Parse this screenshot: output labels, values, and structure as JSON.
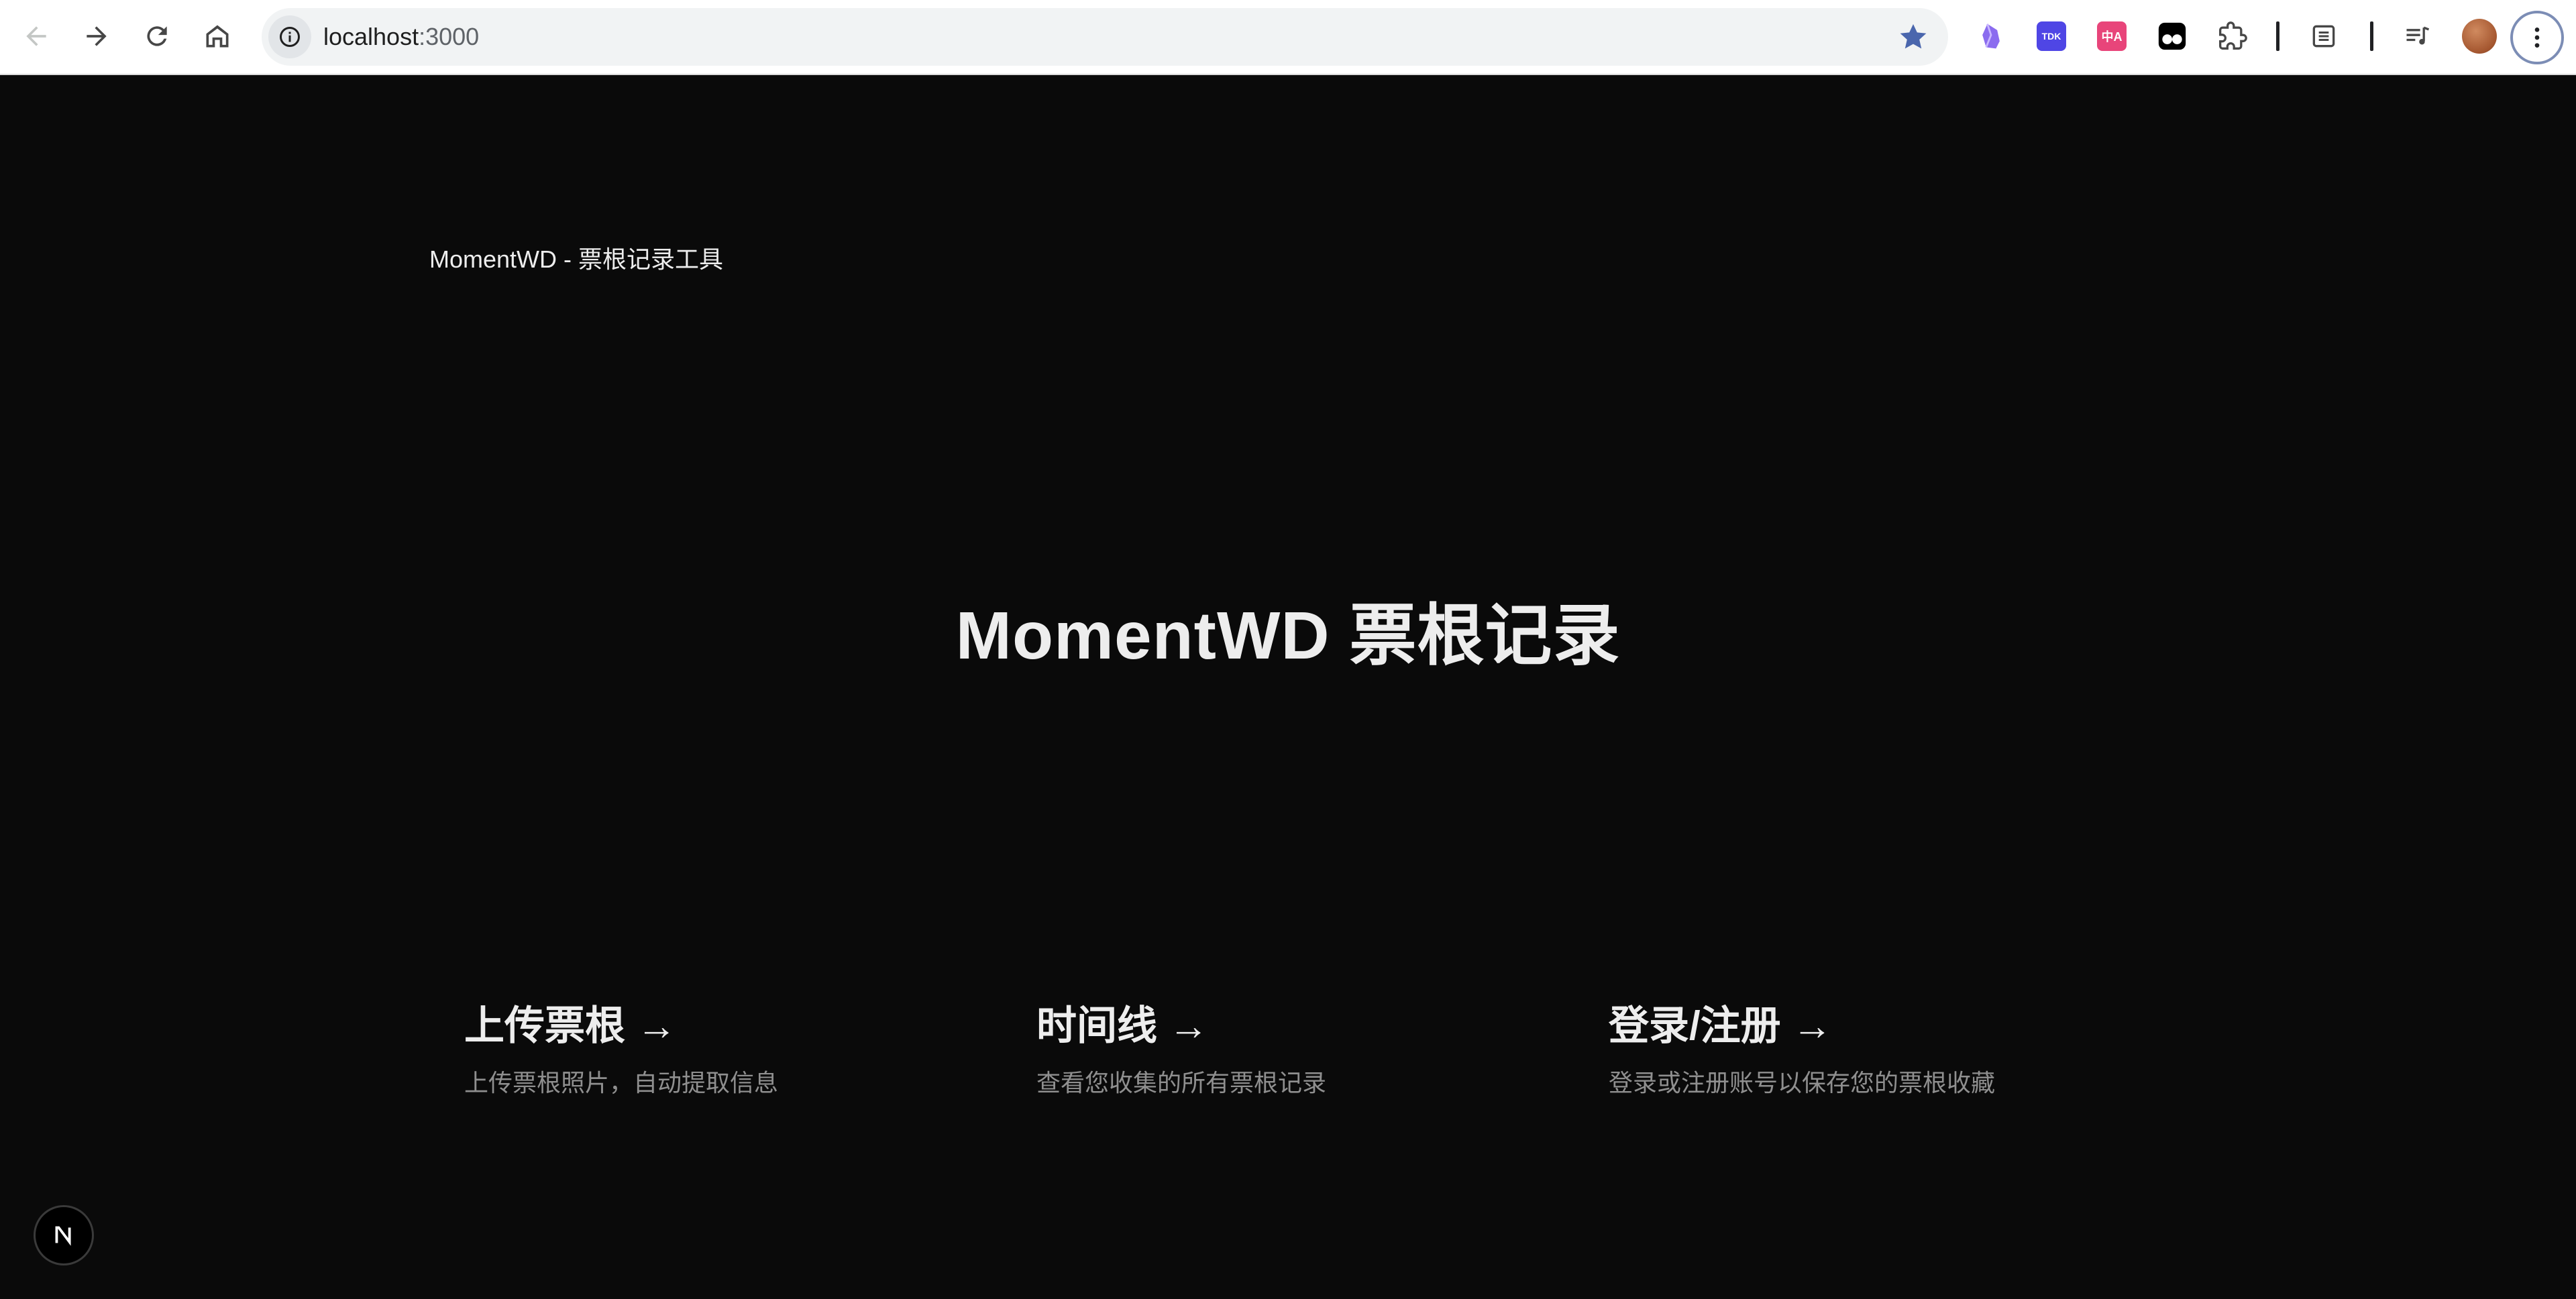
{
  "browser": {
    "url_host": "localhost",
    "url_port": ":3000",
    "extensions": [
      {
        "name": "obsidian-icon",
        "color": "#8b6cef"
      },
      {
        "name": "tdk-extension-icon",
        "label": "TDK",
        "color": "#4f46e5"
      },
      {
        "name": "translate-extension-icon",
        "label": "中A",
        "color": "#e8457a"
      },
      {
        "name": "tampermonkey-icon",
        "color": "#000000"
      }
    ]
  },
  "page": {
    "brand": "MomentWD - 票根记录工具",
    "hero_title": "MomentWD 票根记录",
    "cards": [
      {
        "title": "上传票根 →",
        "description": "上传票根照片，自动提取信息"
      },
      {
        "title": "时间线 →",
        "description": "查看您收集的所有票根记录"
      },
      {
        "title": "登录/注册 →",
        "description": "登录或注册账号以保存您的票根收藏"
      }
    ],
    "dev_badge": "N"
  },
  "colors": {
    "background": "#0a0a0a",
    "foreground": "#ededed",
    "muted": "#8f8f8f",
    "star": "#4a66ad"
  }
}
